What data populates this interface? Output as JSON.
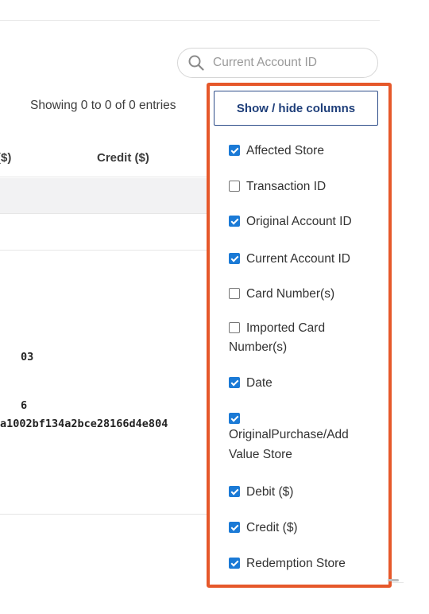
{
  "search": {
    "placeholder": "Current Account ID"
  },
  "table": {
    "info": "Showing 0 to 0 of 0 entries",
    "headers": [
      "($)",
      "Credit ($)"
    ],
    "cells": [
      "03",
      "6",
      "a1002bf134a2bce28166d4e804"
    ]
  },
  "columns_menu": {
    "button_label": "Show / hide columns",
    "options": [
      {
        "label": "Affected Store",
        "checked": true
      },
      {
        "label": "Transaction ID",
        "checked": false
      },
      {
        "label": "Original Account ID",
        "checked": true
      },
      {
        "label": "Current Account ID",
        "checked": true
      },
      {
        "label": "Card Number(s)",
        "checked": false
      },
      {
        "label": "Imported Card Number(s)",
        "checked": false
      },
      {
        "label": "Date",
        "checked": true
      },
      {
        "label": "OriginalPurchase/Add Value Store",
        "checked": true
      },
      {
        "label": "Debit ($)",
        "checked": true
      },
      {
        "label": "Credit ($)",
        "checked": true
      },
      {
        "label": "Redemption Store",
        "checked": true
      }
    ]
  },
  "colors": {
    "highlight_border": "#e6582a",
    "checkbox": "#1b7ad6",
    "button_text": "#1f3f7a"
  }
}
